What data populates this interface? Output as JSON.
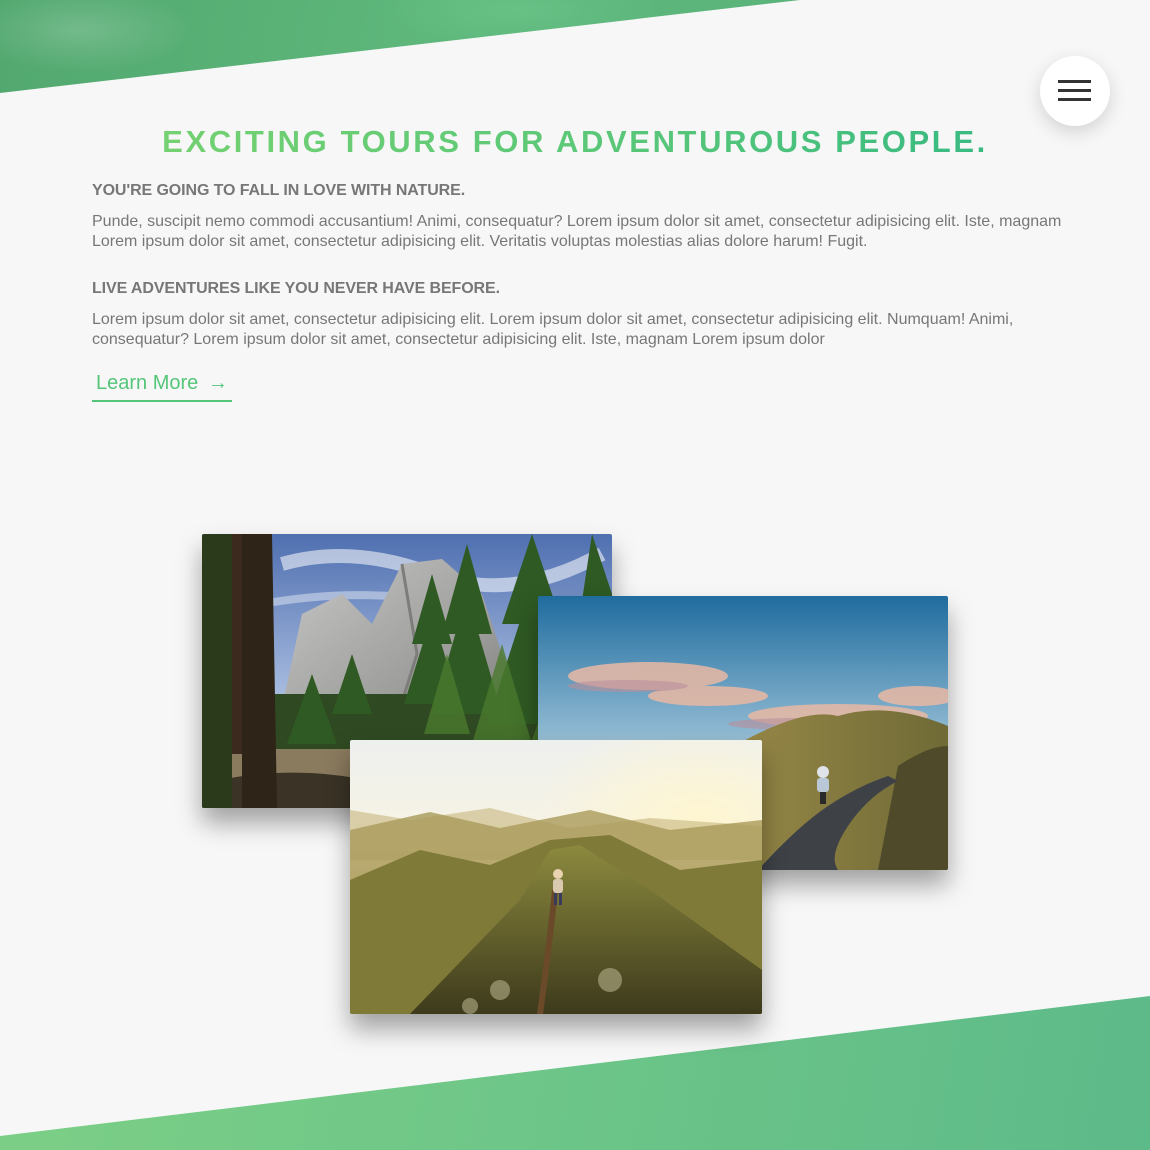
{
  "section": {
    "title": "Exciting tours for adventurous people."
  },
  "features": [
    {
      "heading": "You're going to fall in love with nature.",
      "text": "Punde, suscipit nemo commodi accusantium! Animi, consequatur? Lorem ipsum dolor sit amet, consectetur adipisicing elit. Iste, magnam Lorem ipsum dolor sit amet, consectetur adipisicing elit. Veritatis voluptas molestias alias dolore harum! Fugit."
    },
    {
      "heading": "Live adventures like you never have before.",
      "text": "Lorem ipsum dolor sit amet, consectetur adipisicing elit. Lorem ipsum dolor sit amet, consectetur adipisicing elit. Numquam! Animi, consequatur? Lorem ipsum dolor sit amet, consectetur adipisicing elit. Iste, magnam Lorem ipsum dolor"
    }
  ],
  "cta": {
    "label": "Learn More",
    "arrow": "→"
  },
  "nav": {
    "icon": "hamburger-menu-icon"
  },
  "photos": [
    {
      "subject": "forest-mountain-cliffs"
    },
    {
      "subject": "cyclist-on-hill-road"
    },
    {
      "subject": "hiker-on-mountain-ridge"
    }
  ],
  "colors": {
    "primary": "#55c57a",
    "primary_light": "#7ed56f",
    "primary_dark": "#28b485",
    "text": "#777777",
    "background": "#f7f7f7"
  }
}
